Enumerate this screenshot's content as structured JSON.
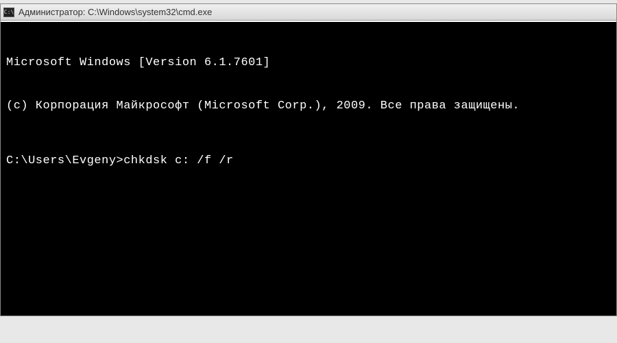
{
  "titlebar": {
    "icon_glyph": "C:\\",
    "title": "Администратор: C:\\Windows\\system32\\cmd.exe"
  },
  "console": {
    "line1": "Microsoft Windows [Version 6.1.7601]",
    "line2": "(c) Корпорация Майкрософт (Microsoft Corp.), 2009. Все права защищены.",
    "prompt": "C:\\Users\\Evgeny>",
    "command": "chkdsk c: /f /r"
  }
}
